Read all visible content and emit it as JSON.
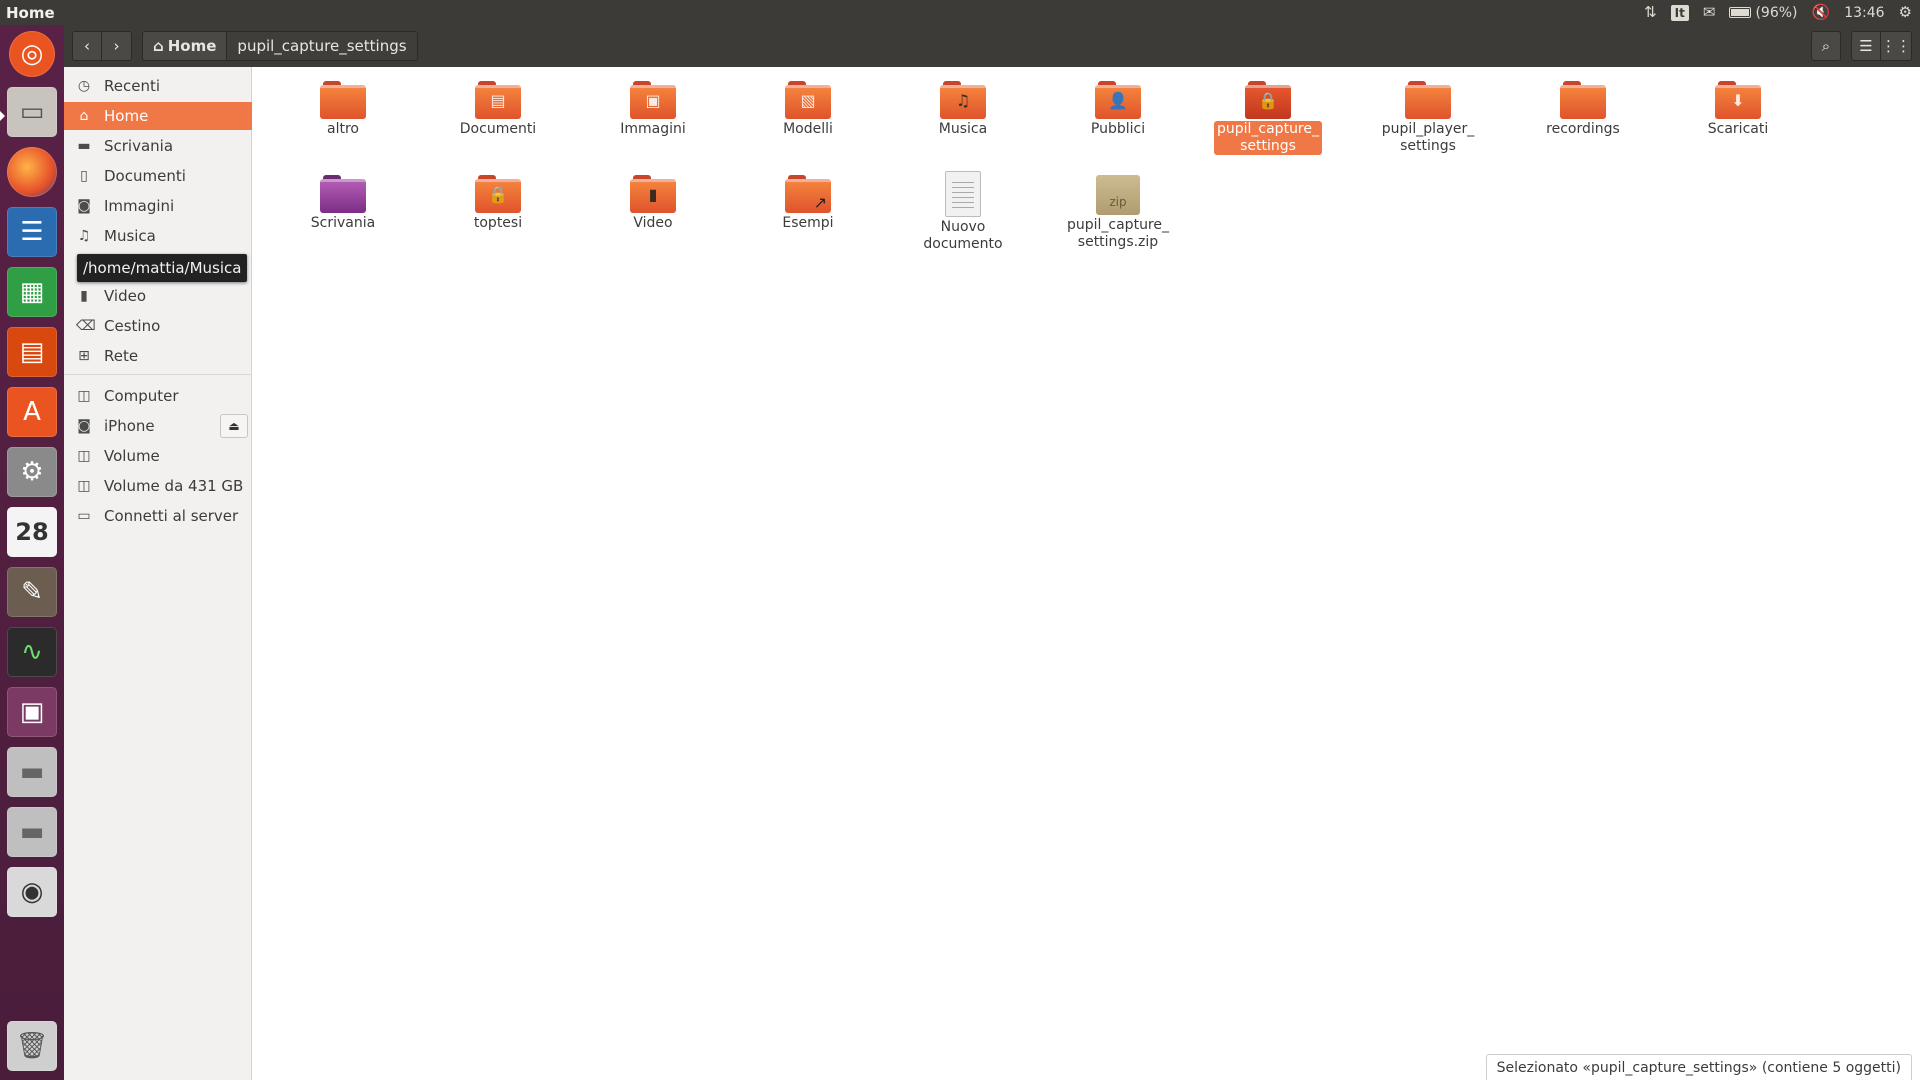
{
  "panel": {
    "title": "Home",
    "keyboard": "It",
    "battery": "(96%)",
    "time": "13:46"
  },
  "launcher": {
    "calendar_day": "28"
  },
  "header": {
    "crumb_home": "Home",
    "crumb_current": "pupil_capture_settings"
  },
  "sidebar": {
    "items": [
      {
        "label": "Recenti",
        "icon": "clock-icon"
      },
      {
        "label": "Home",
        "icon": "home-icon"
      },
      {
        "label": "Scrivania",
        "icon": "folder-icon"
      },
      {
        "label": "Documenti",
        "icon": "document-icon"
      },
      {
        "label": "Immagini",
        "icon": "camera-icon"
      },
      {
        "label": "Musica",
        "icon": "music-icon"
      },
      {
        "label": "Video",
        "icon": "film-icon"
      },
      {
        "label": "Cestino",
        "icon": "trash-icon"
      },
      {
        "label": "Rete",
        "icon": "network-icon"
      }
    ],
    "devices": [
      {
        "label": "Computer",
        "icon": "drive-icon"
      },
      {
        "label": "iPhone",
        "icon": "camera-icon"
      },
      {
        "label": "Volume",
        "icon": "drive-icon"
      },
      {
        "label": "Volume da 431 GB",
        "icon": "drive-icon"
      },
      {
        "label": "Connetti al server",
        "icon": "server-icon"
      }
    ],
    "tooltip": "/home/mattia/Musica"
  },
  "files": [
    {
      "name": "altro",
      "kind": "folder"
    },
    {
      "name": "Documenti",
      "kind": "folder-documents"
    },
    {
      "name": "Immagini",
      "kind": "folder-pictures"
    },
    {
      "name": "Modelli",
      "kind": "folder-templates"
    },
    {
      "name": "Musica",
      "kind": "folder-music"
    },
    {
      "name": "Pubblici",
      "kind": "folder-public"
    },
    {
      "name": "pupil_capture_settings",
      "display": [
        "pupil_capture_",
        "settings"
      ],
      "kind": "folder-locked",
      "selected": true
    },
    {
      "name": "pupil_player_settings",
      "display": [
        "pupil_player_",
        "settings"
      ],
      "kind": "folder"
    },
    {
      "name": "recordings",
      "kind": "folder"
    },
    {
      "name": "Scaricati",
      "kind": "folder-downloads"
    },
    {
      "name": "Scrivania",
      "kind": "folder-desktop"
    },
    {
      "name": "toptesi",
      "kind": "folder-locked"
    },
    {
      "name": "Video",
      "kind": "folder-videos"
    },
    {
      "name": "Esempi",
      "kind": "folder-link"
    },
    {
      "name": "Nuovo documento",
      "kind": "text-document"
    },
    {
      "name": "pupil_capture_settings.zip",
      "display": [
        "pupil_capture_",
        "settings.zip"
      ],
      "kind": "zip-archive",
      "zip_label": "zip"
    }
  ],
  "status": "Selezionato «pupil_capture_settings» (contiene 5 oggetti)"
}
